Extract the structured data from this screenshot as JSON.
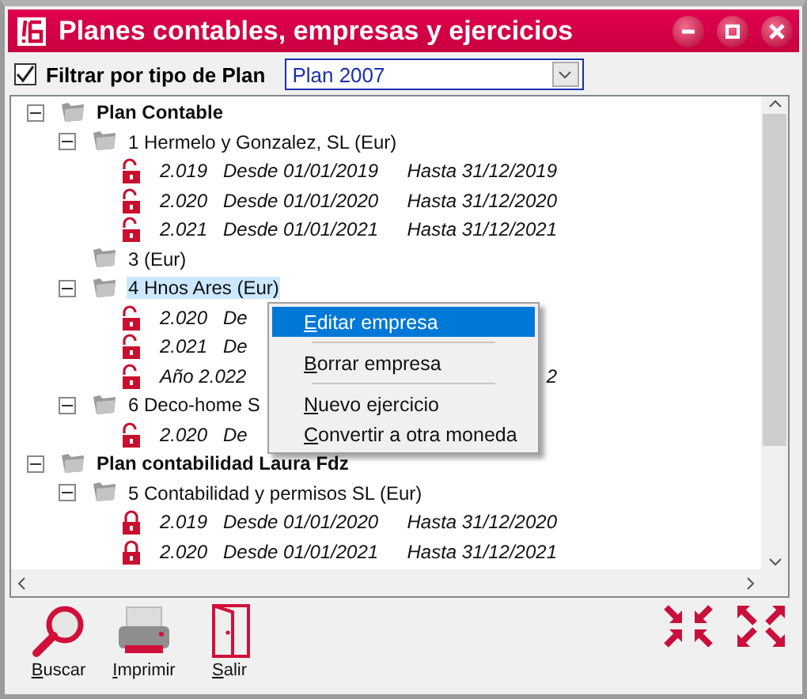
{
  "window": {
    "title": "Planes contables, empresas y ejercicios"
  },
  "filter": {
    "label": "Filtrar por tipo de Plan",
    "checked": true,
    "value": "Plan 2007"
  },
  "tree": [
    {
      "label": "Plan Contable",
      "bold": true,
      "expanded": true,
      "selected": false,
      "children": [
        {
          "label": "1 Hermelo y Gonzalez, SL (Eur)",
          "expanded": true,
          "selected": false,
          "children": [
            {
              "year": "2.019",
              "from": "Desde 01/01/2019",
              "to": "Hasta 31/12/2019",
              "locked": false
            },
            {
              "year": "2.020",
              "from": "Desde 01/01/2020",
              "to": "Hasta 31/12/2020",
              "locked": false
            },
            {
              "year": "2.021",
              "from": "Desde 01/01/2021",
              "to": "Hasta 31/12/2021",
              "locked": false
            }
          ]
        },
        {
          "label": "3  (Eur)",
          "selected": false
        },
        {
          "label": "4 Hnos Ares (Eur)",
          "expanded": true,
          "selected": true,
          "children": [
            {
              "year": "2.020",
              "from": "De",
              "locked": false
            },
            {
              "year": "2.021",
              "from": "De",
              "locked": false
            },
            {
              "year": "Año 2.022",
              "to": "2",
              "locked": false
            }
          ]
        },
        {
          "label": "6 Deco-home S",
          "expanded": true,
          "selected": false,
          "children": [
            {
              "year": "2.020",
              "from": "De",
              "locked": false
            }
          ]
        }
      ]
    },
    {
      "label": "Plan contabilidad Laura Fdz",
      "bold": true,
      "expanded": true,
      "selected": false,
      "children": [
        {
          "label": "5 Contabilidad y permisos SL (Eur)",
          "expanded": true,
          "selected": false,
          "children": [
            {
              "year": "2.019",
              "from": "Desde 01/01/2020",
              "to": "Hasta 31/12/2020",
              "locked": true
            },
            {
              "year": "2.020",
              "from": "Desde 01/01/2021",
              "to": "Hasta 31/12/2021",
              "locked": true
            }
          ]
        }
      ]
    }
  ],
  "context_menu": [
    {
      "kind": "item",
      "label": "Editar empresa",
      "selected": true
    },
    {
      "kind": "separator"
    },
    {
      "kind": "item",
      "label": "Borrar empresa",
      "selected": false
    },
    {
      "kind": "separator"
    },
    {
      "kind": "item",
      "label": "Nuevo ejercicio",
      "selected": false
    },
    {
      "kind": "item",
      "label": "Convertir a otra moneda",
      "selected": false
    }
  ],
  "toolbar": [
    {
      "kind": "search",
      "label": "Buscar"
    },
    {
      "kind": "print",
      "label": "Imprimir"
    },
    {
      "kind": "exit",
      "label": "Salir"
    }
  ]
}
